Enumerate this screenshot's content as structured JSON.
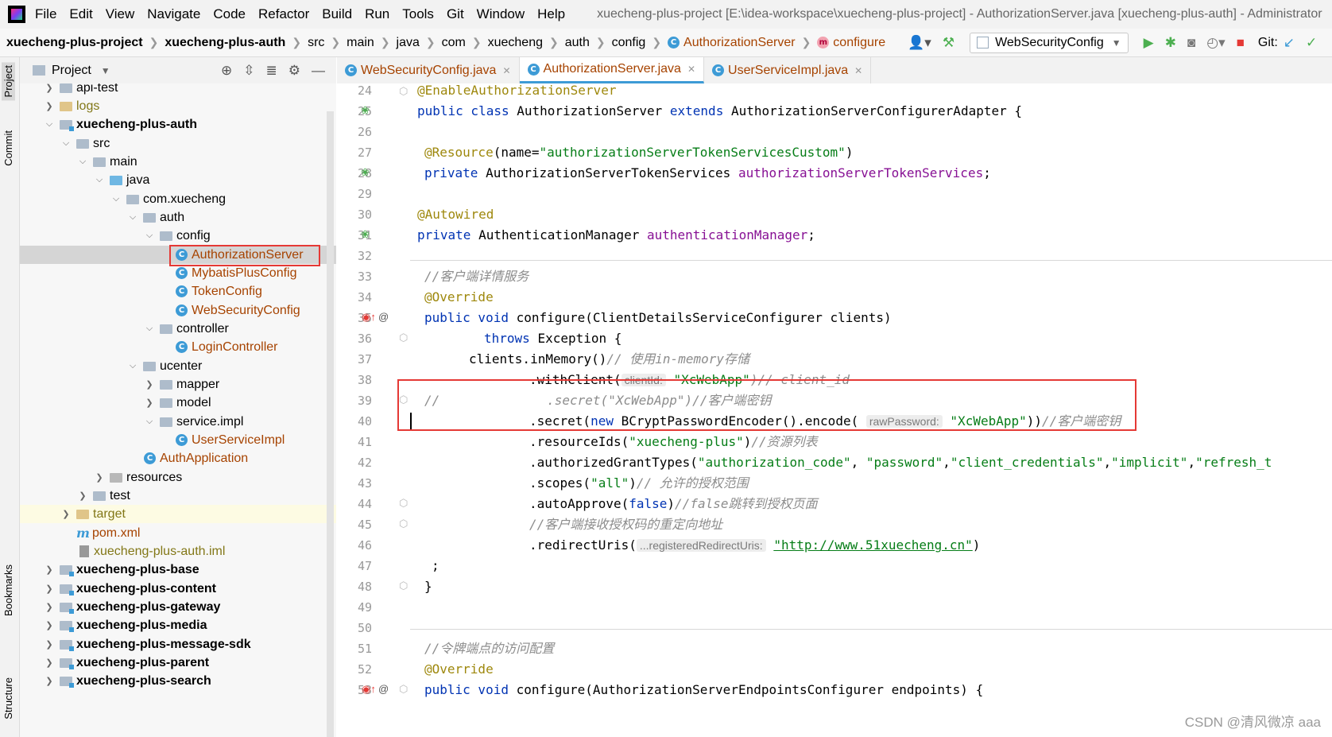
{
  "menu": {
    "items": [
      "File",
      "Edit",
      "View",
      "Navigate",
      "Code",
      "Refactor",
      "Build",
      "Run",
      "Tools",
      "Git",
      "Window",
      "Help"
    ],
    "title": "xuecheng-plus-project [E:\\idea-workspace\\xuecheng-plus-project] - AuthorizationServer.java [xuecheng-plus-auth] - Administrator"
  },
  "breadcrumb": {
    "items": [
      "xuecheng-plus-project",
      "xuecheng-plus-auth",
      "src",
      "main",
      "java",
      "com",
      "xuecheng",
      "auth",
      "config",
      "AuthorizationServer",
      "configure"
    ]
  },
  "toolbar": {
    "run_config": "WebSecurityConfig",
    "git_label": "Git:"
  },
  "project_panel": {
    "title": "Project",
    "tree": [
      {
        "label": "api-test"
      },
      {
        "label": "logs"
      },
      {
        "label": "xuecheng-plus-auth"
      },
      {
        "label": "src"
      },
      {
        "label": "main"
      },
      {
        "label": "java"
      },
      {
        "label": "com.xuecheng"
      },
      {
        "label": "auth"
      },
      {
        "label": "config"
      },
      {
        "label": "AuthorizationServer"
      },
      {
        "label": "MybatisPlusConfig"
      },
      {
        "label": "TokenConfig"
      },
      {
        "label": "WebSecurityConfig"
      },
      {
        "label": "controller"
      },
      {
        "label": "LoginController"
      },
      {
        "label": "ucenter"
      },
      {
        "label": "mapper"
      },
      {
        "label": "model"
      },
      {
        "label": "service.impl"
      },
      {
        "label": "UserServiceImpl"
      },
      {
        "label": "AuthApplication"
      },
      {
        "label": "resources"
      },
      {
        "label": "test"
      },
      {
        "label": "target"
      },
      {
        "label": "pom.xml"
      },
      {
        "label": "xuecheng-plus-auth.iml"
      },
      {
        "label": "xuecheng-plus-base"
      },
      {
        "label": "xuecheng-plus-content"
      },
      {
        "label": "xuecheng-plus-gateway"
      },
      {
        "label": "xuecheng-plus-media"
      },
      {
        "label": "xuecheng-plus-message-sdk"
      },
      {
        "label": "xuecheng-plus-parent"
      },
      {
        "label": "xuecheng-plus-search"
      }
    ]
  },
  "side_tabs": [
    "Project",
    "Commit",
    "Bookmarks",
    "Structure"
  ],
  "editor": {
    "tabs": [
      "WebSecurityConfig.java",
      "AuthorizationServer.java",
      "UserServiceImpl.java"
    ],
    "active_tab": 1,
    "line_numbers": [
      "24",
      "25",
      "26",
      "27",
      "28",
      "29",
      "30",
      "31",
      "32",
      "33",
      "34",
      "35",
      "36",
      "37",
      "38",
      "39",
      "40",
      "41",
      "42",
      "43",
      "44",
      "45",
      "46",
      "47",
      "48",
      "49",
      "50",
      "51",
      "52",
      "53"
    ],
    "code": {
      "l24": "@EnableAuthorizationServer",
      "l25_a": "public class ",
      "l25_b": "AuthorizationServer ",
      "l25_c": "extends ",
      "l25_d": "AuthorizationServerConfigurerAdapter {",
      "l27_a": "@Resource",
      "l27_b": "(name=",
      "l27_c": "\"authorizationServerTokenServicesCustom\"",
      "l27_d": ")",
      "l28_a": "private ",
      "l28_b": "AuthorizationServerTokenServices ",
      "l28_c": "authorizationServerTokenServices",
      "l28_d": ";",
      "l30": "@Autowired",
      "l31_a": "private ",
      "l31_b": "AuthenticationManager ",
      "l31_c": "authenticationManager",
      "l31_d": ";",
      "l33": "//客户端详情服务",
      "l34": "@Override",
      "l35_a": "public void ",
      "l35_b": "configure(ClientDetailsServiceConfigurer clients)",
      "l36_a": "throws ",
      "l36_b": "Exception {",
      "l37_a": "clients.inMemory()",
      "l37_b": "// 使用in-memory存储",
      "l38_a": ".withClient(",
      "l38_hint": "clientId:",
      "l38_b": "\"XcWebApp\"",
      "l38_c": ")// client_id",
      "l39": "//              .secret(\"XcWebApp\")//客户端密钥",
      "l40_a": ".secret(",
      "l40_b": "new ",
      "l40_c": "BCryptPasswordEncoder().encode(",
      "l40_hint": "rawPassword:",
      "l40_d": "\"XcWebApp\"",
      "l40_e": "))",
      "l40_f": "//客户端密钥",
      "l41_a": ".resourceIds(",
      "l41_b": "\"xuecheng-plus\"",
      "l41_c": ")",
      "l41_d": "//资源列表",
      "l42_a": ".authorizedGrantTypes(",
      "l42_b": "\"authorization_code\"",
      "l42_c": ", ",
      "l42_d": "\"password\"",
      "l42_e": ",",
      "l42_f": "\"client_credentials\"",
      "l42_g": ",",
      "l42_h": "\"implicit\"",
      "l42_i": ",",
      "l42_j": "\"refresh_t",
      "l43_a": ".scopes(",
      "l43_b": "\"all\"",
      "l43_c": ")",
      "l43_d": "// 允许的授权范围",
      "l44_a": ".autoApprove(",
      "l44_b": "false",
      "l44_c": ")",
      "l44_d": "//false跳转到授权页面",
      "l45": "//客户端接收授权码的重定向地址",
      "l46_a": ".redirectUris(",
      "l46_hint": "...registeredRedirectUris:",
      "l46_b": "\"http://www.51xuecheng.cn\"",
      "l46_c": ")",
      "l47": ";",
      "l48": "}",
      "l51": "//令牌端点的访问配置",
      "l52": "@Override",
      "l53_a": "public void ",
      "l53_b": "configure(AuthorizationServerEndpointsConfigurer endpoints) {"
    }
  },
  "watermark": "CSDN @清风微凉 aaa",
  "colors": {
    "highlight_box": "#e53935",
    "accent": "#3d9bd6"
  }
}
